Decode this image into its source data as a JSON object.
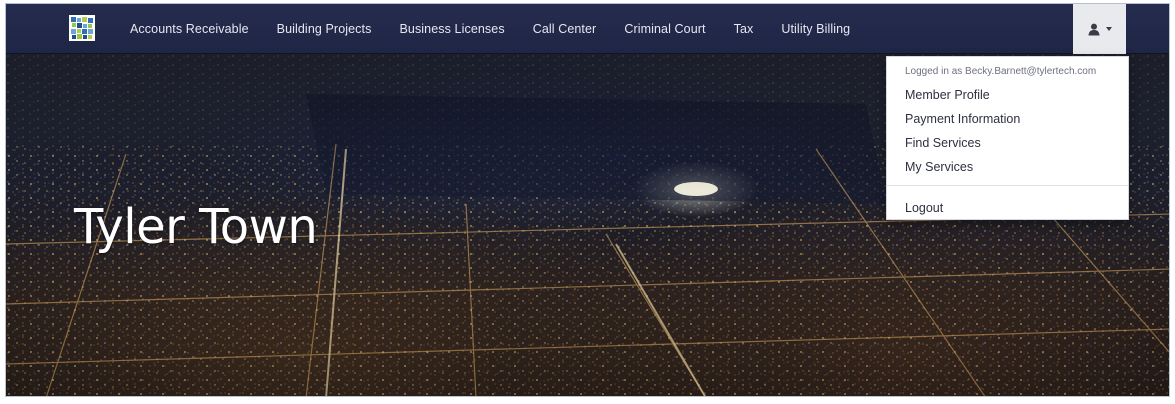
{
  "navbar": {
    "logo_icon": "tyler-logo-icon",
    "items": [
      {
        "label": "Accounts Receivable"
      },
      {
        "label": "Building Projects"
      },
      {
        "label": "Business Licenses"
      },
      {
        "label": "Call Center"
      },
      {
        "label": "Criminal Court"
      },
      {
        "label": "Tax"
      },
      {
        "label": "Utility Billing"
      }
    ],
    "user_menu_icon": "user-icon",
    "colors": {
      "background": "#23294a",
      "text": "#e6e8f0",
      "toggle_active": "#e9eaee"
    }
  },
  "hero": {
    "title": "Tyler Town",
    "background": "night-city-aerial-image"
  },
  "user_dropdown": {
    "header": "Logged in as Becky.Barnett@tylertech.com",
    "items": [
      {
        "label": "Member Profile"
      },
      {
        "label": "Payment Information"
      },
      {
        "label": "Find Services"
      },
      {
        "label": "My Services"
      }
    ],
    "logout_label": "Logout"
  }
}
